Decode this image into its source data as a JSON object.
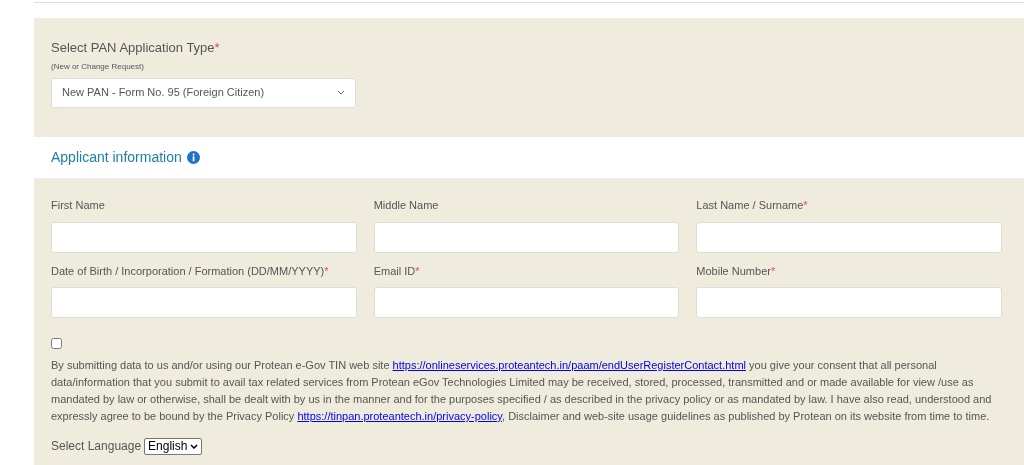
{
  "application_type": {
    "label": "Select PAN Application Type",
    "required_mark": "*",
    "hint": "(New or Change Request)",
    "value": "New PAN - Form No. 95 (Foreign Citizen)"
  },
  "section_title": "Applicant information",
  "fields": [
    {
      "label": "First Name"
    },
    {
      "label": "Middle Name"
    },
    {
      "label": "Last Name / Surname",
      "required_mark": "*"
    },
    {
      "label": "Date of Birth / Incorporation / Formation (DD/MM/YYYY)",
      "required_mark": "*"
    },
    {
      "label": "Email ID",
      "required_mark": "*"
    },
    {
      "label": "Mobile Number",
      "required_mark": "*"
    }
  ],
  "consent": {
    "checked": false,
    "parts": [
      {
        "kind": "text",
        "text": "By submitting data to us and/or using our Protean e-Gov TIN web site "
      },
      {
        "kind": "link",
        "text": "https://onlineservices.proteantech.in/paam/endUserRegisterContact.html"
      },
      {
        "kind": "text",
        "text": " you give your consent that all personal data/information that you submit to avail tax related services from Protean eGov Technologies Limited may be received, stored, processed, transmitted and or made available for view /use as mandated by law or otherwise, shall be dealt with by us in the manner and for the purposes specified / as described in the privacy policy or as mandated by law. I have also read, understood and expressly agree to be bound by the Privacy Policy "
      },
      {
        "kind": "link",
        "text": "https://tinpan.proteantech.in/privacy-policy"
      },
      {
        "kind": "text",
        "text": ", Disclaimer and web-site usage guidelines as published by Protean on its website from time to time."
      }
    ]
  },
  "language": {
    "label": "Select Language",
    "value": "English"
  }
}
